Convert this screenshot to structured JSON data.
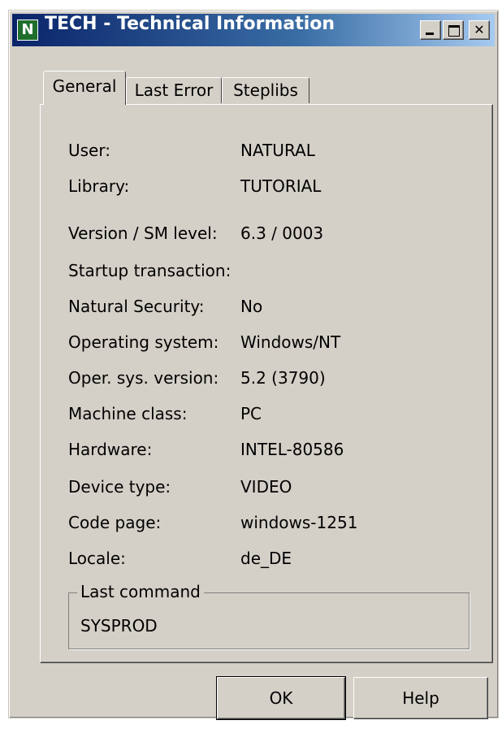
{
  "window": {
    "title": "TECH - Technical Information",
    "icon_name": "natural-app-icon",
    "icon_glyph": "N",
    "minimize_label": "",
    "maximize_label": "",
    "close_label": "✕"
  },
  "tabs": [
    {
      "label": "General",
      "active": true
    },
    {
      "label": "Last Error",
      "active": false
    },
    {
      "label": "Steplibs",
      "active": false
    }
  ],
  "general": {
    "rows": [
      {
        "label": "User:",
        "value": "NATURAL"
      },
      {
        "label": "Library:",
        "value": "TUTORIAL"
      },
      {
        "label": "Version / SM level:",
        "value": "6.3 / 0003"
      },
      {
        "label": "Startup transaction:",
        "value": ""
      },
      {
        "label": "Natural Security:",
        "value": "No"
      },
      {
        "label": "Operating system:",
        "value": "Windows/NT"
      },
      {
        "label": "Oper. sys. version:",
        "value": "5.2 (3790)"
      },
      {
        "label": "Machine class:",
        "value": "PC"
      },
      {
        "label": "Hardware:",
        "value": "INTEL-80586"
      },
      {
        "label": "Device type:",
        "value": "VIDEO"
      },
      {
        "label": "Code page:",
        "value": "windows-1251"
      },
      {
        "label": "Locale:",
        "value": "de_DE"
      }
    ],
    "last_command": {
      "title": "Last command",
      "value": "SYSPROD"
    }
  },
  "buttons": {
    "ok": "OK",
    "help": "Help"
  }
}
